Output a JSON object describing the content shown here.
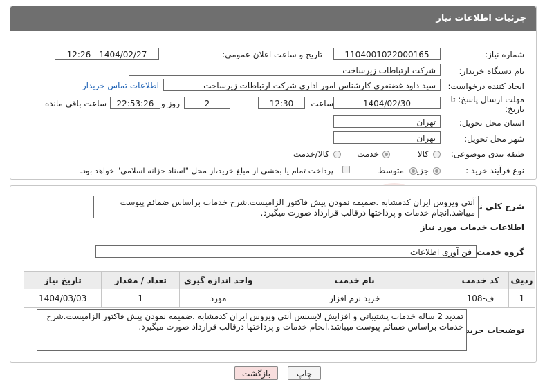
{
  "header": {
    "title": "جزئیات اطلاعات نیاز"
  },
  "fields": {
    "need_number_label": "شماره نیاز:",
    "need_number": "1104001022000165",
    "announce_label": "تاریخ و ساعت اعلان عمومی:",
    "announce_value": "1404/02/27 - 12:26",
    "buyer_org_label": "نام دستگاه خریدار:",
    "buyer_org": "شرکت ارتباطات زیرساخت",
    "requester_label": "ایجاد کننده درخواست:",
    "requester": "سید داود غضنفری کارشناس امور اداری شرکت ارتباطات زیرساخت",
    "contact_link": "اطلاعات تماس خریدار",
    "deadline_label_1": "مهلت ارسال پاسخ: تا",
    "deadline_label_2": "تاریخ:",
    "deadline_date": "1404/02/30",
    "time_label": "ساعت",
    "deadline_time": "12:30",
    "days_value": "2",
    "days_label": "روز و",
    "remaining_time": "22:53:26",
    "remaining_label": "ساعت باقی مانده",
    "province_label": "استان محل تحویل:",
    "province": "تهران",
    "city_label": "شهر محل تحویل:",
    "city": "تهران",
    "category_label": "طبقه بندی موضوعی:",
    "category_options": [
      "کالا",
      "خدمت",
      "کالا/خدمت"
    ],
    "category_selected": "خدمت",
    "process_label": "نوع فرآیند خرید :",
    "process_options": [
      "جزیی",
      "متوسط"
    ],
    "process_selected": "جزیی",
    "payment_note": "پرداخت تمام یا بخشی از مبلغ خرید،از محل \"اسناد خزانه اسلامی\" خواهد بود."
  },
  "summary": {
    "label": "شرح کلی نیاز:",
    "text": "آنتی ویروس ایران کدمشابه .ضمیمه نمودن پیش فاکتور الزامیست.شرح خدمات براساس ضمائم پیوست میباشد.انجام خدمات و پرداختها درقالب قرارداد صورت میگیرد."
  },
  "services": {
    "title": "اطلاعات خدمات مورد نیاز",
    "group_label": "گروه خدمت:",
    "group_value": "فن آوری اطلاعات",
    "columns": [
      "ردیف",
      "کد خدمت",
      "نام خدمت",
      "واحد اندازه گیری",
      "تعداد / مقدار",
      "تاریخ نیاز"
    ],
    "rows": [
      {
        "row": "1",
        "code": "ف-108",
        "name": "خرید نرم افزار",
        "unit": "مورد",
        "qty": "1",
        "date": "1404/03/03"
      }
    ]
  },
  "buyer_notes": {
    "label": "توضیحات خریدار:",
    "text": "تمدید 2 ساله خدمات پشتیبانی و افزایش لایسنس آنتی ویروس ایران کدمشابه .ضمیمه نمودن پیش فاکتور الزامیست.شرح خدمات براساس ضمائم پیوست میباشد.انجام خدمات و پرداختها درقالب قرارداد صورت میگیرد."
  },
  "buttons": {
    "print": "چاپ",
    "back": "بازگشت"
  },
  "colors": {
    "header_bg": "#6f6f6f",
    "link": "#1a5fb4",
    "back_bg": "#f8dede"
  }
}
